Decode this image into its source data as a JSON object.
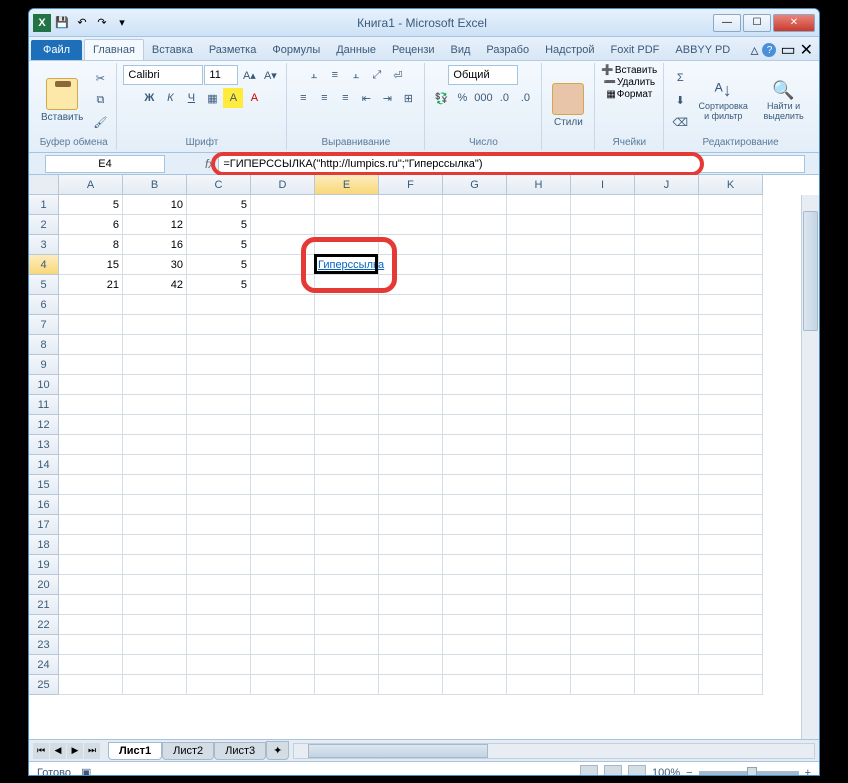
{
  "title": "Книга1 - Microsoft Excel",
  "file_tab": "Файл",
  "tabs": [
    "Главная",
    "Вставка",
    "Разметка",
    "Формулы",
    "Данные",
    "Рецензи",
    "Вид",
    "Разрабо",
    "Надстрой",
    "Foxit PDF",
    "ABBYY PD"
  ],
  "active_tab": 0,
  "ribbon": {
    "clipboard": {
      "paste": "Вставить",
      "label": "Буфер обмена"
    },
    "font": {
      "name": "Calibri",
      "size": "11",
      "label": "Шрифт",
      "bold": "Ж",
      "italic": "К",
      "underline": "Ч"
    },
    "alignment": {
      "label": "Выравнивание"
    },
    "number": {
      "format": "Общий",
      "label": "Число"
    },
    "styles": {
      "btn": "Стили"
    },
    "cells": {
      "insert": "Вставить",
      "delete": "Удалить",
      "format": "Формат",
      "label": "Ячейки"
    },
    "editing": {
      "sort": "Сортировка и фильтр",
      "find": "Найти и выделить",
      "label": "Редактирование"
    }
  },
  "namebox": "E4",
  "formula": "=ГИПЕРССЫЛКА(\"http://lumpics.ru\";\"Гиперссылка\")",
  "columns": [
    "A",
    "B",
    "C",
    "D",
    "E",
    "F",
    "G",
    "H",
    "I",
    "J",
    "K"
  ],
  "active_col": 4,
  "active_row": 3,
  "rows_visible": 25,
  "cells": {
    "r0": [
      "5",
      "10",
      "5",
      "",
      "",
      "",
      "",
      "",
      "",
      "",
      ""
    ],
    "r1": [
      "6",
      "12",
      "5",
      "",
      "",
      "",
      "",
      "",
      "",
      "",
      ""
    ],
    "r2": [
      "8",
      "16",
      "5",
      "",
      "",
      "",
      "",
      "",
      "",
      "",
      ""
    ],
    "r3": [
      "15",
      "30",
      "5",
      "",
      "Гиперссылка",
      "",
      "",
      "",
      "",
      "",
      ""
    ],
    "r4": [
      "21",
      "42",
      "5",
      "",
      "",
      "",
      "",
      "",
      "",
      "",
      ""
    ]
  },
  "sheets": [
    "Лист1",
    "Лист2",
    "Лист3"
  ],
  "active_sheet": 0,
  "status": "Готово",
  "zoom": "100%"
}
